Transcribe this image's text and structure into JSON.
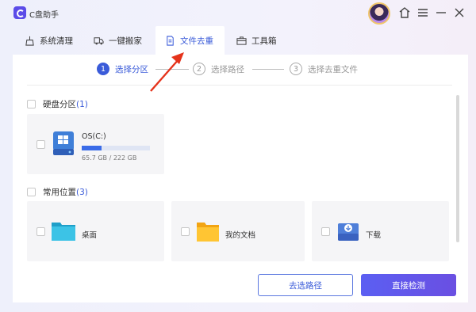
{
  "app": {
    "title": "C盘助手"
  },
  "tabs": [
    {
      "label": "系统清理",
      "icon": "sweep-icon"
    },
    {
      "label": "一键搬家",
      "icon": "truck-icon"
    },
    {
      "label": "文件去重",
      "icon": "file-icon",
      "active": true
    },
    {
      "label": "工具箱",
      "icon": "toolbox-icon"
    }
  ],
  "steps": [
    {
      "num": "1",
      "label": "选择分区",
      "active": true
    },
    {
      "num": "2",
      "label": "选择路径"
    },
    {
      "num": "3",
      "label": "选择去重文件"
    }
  ],
  "partitions": {
    "title": "硬盘分区",
    "count": "(1)",
    "items": [
      {
        "name": "OS(C:)",
        "size_text": "65.7 GB / 222 GB",
        "usage_fraction": 0.296
      }
    ]
  },
  "locations": {
    "title": "常用位置",
    "count": "(3)",
    "items": [
      {
        "label": "桌面",
        "icon": "desktop-folder-icon"
      },
      {
        "label": "我的文档",
        "icon": "documents-folder-icon"
      },
      {
        "label": "下载",
        "icon": "download-folder-icon"
      }
    ]
  },
  "buttons": {
    "choose_path": "去选路径",
    "detect": "直接检测"
  },
  "colors": {
    "accent": "#3a5bd9",
    "primary_button": "#5b5ff2",
    "arrow": "#e5331b"
  }
}
